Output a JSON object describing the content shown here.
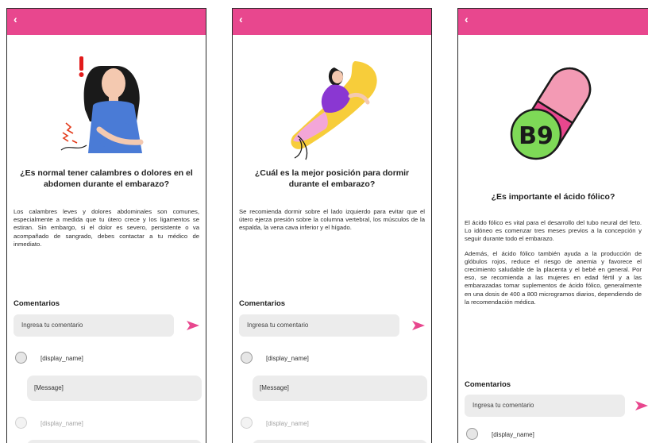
{
  "screens": [
    {
      "back": "‹",
      "title": "¿Es normal tener calambres o dolores en el abdomen durante el embarazo?",
      "paragraphs": [
        "Los calambres leves y dolores abdominales son comunes, especialmente a medida que tu útero crece y los ligamentos se estiran. Sin embargo, si el dolor es severo, persistente o va acompañado de sangrado, debes contactar a tu médico de inmediato."
      ],
      "comments_title": "Comentarios",
      "comment_placeholder": "Ingresa tu comentario",
      "comments": [
        {
          "display_name": "[display_name]",
          "message": "[Message]"
        },
        {
          "display_name": "[display_name]"
        }
      ]
    },
    {
      "back": "‹",
      "title": "¿Cuál es la mejor posición para dormir durante el embarazo?",
      "paragraphs": [
        "Se recomienda dormir sobre el lado izquierdo para evitar que el útero ejerza presión sobre la columna vertebral, los músculos de la espalda, la vena cava inferior y el hígado."
      ],
      "comments_title": "Comentarios",
      "comment_placeholder": "Ingresa tu comentario",
      "comments": [
        {
          "display_name": "[display_name]",
          "message": "[Message]"
        },
        {
          "display_name": "[display_name]"
        }
      ]
    },
    {
      "back": "‹",
      "pill_label": "B9",
      "title": "¿Es importante el ácido fólico?",
      "paragraphs": [
        "El ácido fólico es vital para el desarrollo del tubo neural del feto. Lo idóneo es comenzar tres meses previos a la concepción y seguir durante todo el embarazo.",
        "Además, el ácido fólico también ayuda a la producción de glóbulos rojos, reduce el riesgo de anemia y favorece el crecimiento saludable de la placenta y el bebé en general. Por eso, se recomienda a las mujeres en edad fértil y a las embarazadas tomar suplementos de ácido fólico, generalmente en una dosis de 400 a 800 microgramos diarios, dependiendo de la recomendación médica."
      ],
      "comments_title": "Comentarios",
      "comment_placeholder": "Ingresa tu comentario",
      "comments": [
        {
          "display_name": "[display_name]"
        }
      ]
    }
  ],
  "colors": {
    "accent": "#e8478e",
    "input_bg": "#ececec",
    "pill_pink": "#e8478e",
    "pill_green": "#7ed957"
  }
}
